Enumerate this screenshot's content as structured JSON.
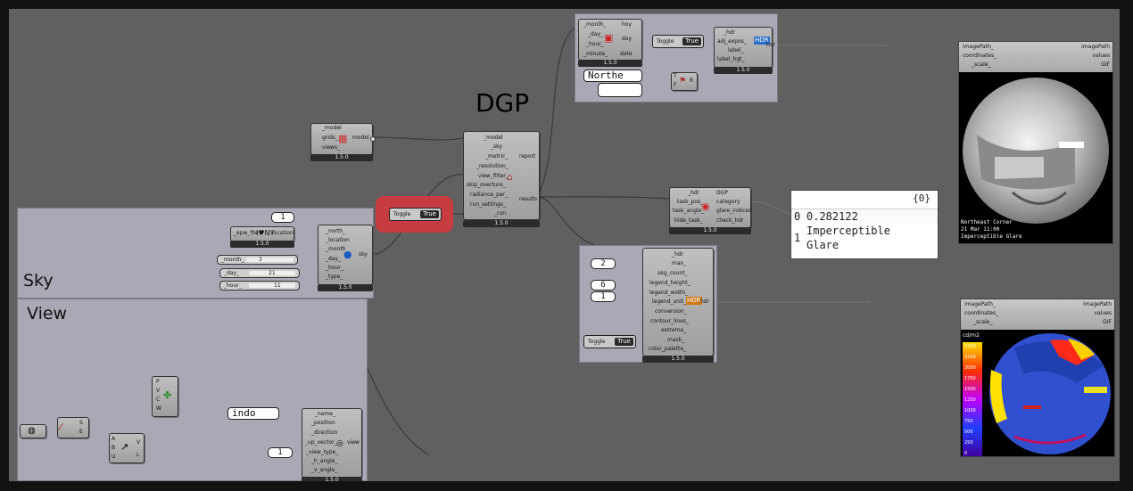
{
  "groups": {
    "sky": "Sky",
    "view": "View"
  },
  "title_label": "DGP",
  "version": "1.5.0",
  "model_comp": {
    "inputs": [
      "_model",
      "grids_",
      "views_"
    ],
    "output": "model"
  },
  "location_comp": {
    "input": "_epw_file",
    "output": "location"
  },
  "sky_comp": {
    "inputs": [
      "_north_",
      "_location",
      "_month",
      "_day_",
      "_hour_",
      "_type_"
    ],
    "output": "sky"
  },
  "sliders": [
    {
      "label": "_month_",
      "value": "3"
    },
    {
      "label": "_day_",
      "value": "21"
    },
    {
      "label": "_hour_",
      "value": "11"
    }
  ],
  "north_value": "1",
  "toggle_main": {
    "label": "Toggle",
    "value": "True"
  },
  "recipe_comp": {
    "inputs": [
      "_model",
      "_sky",
      "_metric_",
      "_resolution_",
      "view_filter_",
      "skip_overture_",
      "radiance_par_",
      "run_settings_",
      "_run"
    ],
    "outputs": [
      "report",
      "results"
    ]
  },
  "datetime_comp": {
    "inputs": [
      "_month_",
      "_day_",
      "_hour_",
      "_minute_"
    ],
    "outputs": [
      "hoy",
      "day",
      "date"
    ]
  },
  "toggle_top": {
    "label": "Toggle",
    "value": "True"
  },
  "adjust_comp": {
    "inputs": [
      "_hdr",
      "adj_expos_",
      "label_",
      "label_hgt_"
    ],
    "output": "hdr"
  },
  "text_input": "Northe",
  "concat_comp": {
    "inputs": [
      "T",
      "F"
    ],
    "output": "R"
  },
  "glare_comp": {
    "inputs": [
      "_hdr",
      "task_pos_",
      "task_angle_",
      "hide_task_"
    ],
    "outputs": [
      "DGP",
      "category",
      "glare_indices",
      "check_hdr"
    ]
  },
  "result_panel": {
    "header": "{0}",
    "rows": [
      {
        "index": "0",
        "text": "0.282122"
      },
      {
        "index": "1",
        "text": "Imperceptible Glare"
      }
    ]
  },
  "falsecolor_comp": {
    "inputs": [
      "_hdr",
      "max_",
      "seg_count_",
      "legend_height_",
      "legend_width_",
      "legend_unit_",
      "conversion_",
      "contour_lines_",
      "extrema_",
      "mask_",
      "color_palette_"
    ],
    "output": "hdr"
  },
  "fc_numbers": [
    "2",
    "6",
    "1"
  ],
  "toggle_fc": {
    "label": "Toggle",
    "value": "True"
  },
  "image_viewer_1": {
    "inputs": [
      "imagePath_",
      "coordinates_",
      "_scale_"
    ],
    "outputs": [
      "imagePath",
      "values",
      "GIF"
    ],
    "caption": [
      "Northeast Corner",
      "21 Mar 11:00",
      "Imperceptible Glare"
    ]
  },
  "image_viewer_2": {
    "inputs": [
      "imagePath_",
      "coordinates_",
      "_scale_"
    ],
    "outputs": [
      "imagePath",
      "values",
      "GIF"
    ],
    "legend_title": "cd/m2",
    "legend_values": [
      "2250",
      "2250",
      "2000",
      "1750",
      "1500",
      "1250",
      "1000",
      "750",
      "500",
      "250",
      "0"
    ]
  },
  "view_comp": {
    "inputs": [
      "_name_",
      "_position",
      "_direction",
      "_up_vector_",
      "_view_type_",
      "_h_angle_",
      "_v_angle_"
    ],
    "output": "view"
  },
  "view_name_input": "indo",
  "view_type_value": "1",
  "point_comp": {
    "outputs": [
      "S",
      "E"
    ]
  },
  "vector_comp": {
    "inputs": [
      "A",
      "B",
      "U"
    ],
    "outputs": [
      "V",
      "L"
    ]
  },
  "deconstruct_comp": {
    "outputs": [
      "P",
      "V",
      "C",
      "W"
    ]
  },
  "colors": {
    "group_red": "#c63c40",
    "canvas": "#606060",
    "group": "#a9a8b4"
  }
}
